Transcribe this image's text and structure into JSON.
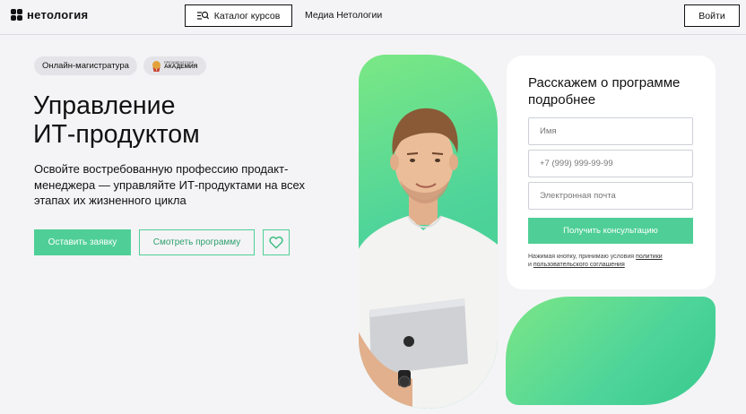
{
  "header": {
    "logo_text": "нетология",
    "catalog_label": "Каталог курсов",
    "media_label": "Медиа Нетологии",
    "login_label": "Войти"
  },
  "hero": {
    "badge_label": "Онлайн-магистратура",
    "academy_small": "ПРЕЗИДЕНТСКАЯ",
    "academy_big": "АКАДЕМИЯ",
    "title_line1": "Управление",
    "title_line2": "ИТ-продуктом",
    "subtitle": "Освойте востребованную профессию продакт-менеджера — управляйте ИТ-продуктами на всех этапах их жизненного цикла",
    "apply_label": "Оставить заявку",
    "program_label": "Смотреть программу"
  },
  "form": {
    "title": "Расскажем о программе подробнее",
    "name_placeholder": "Имя",
    "phone_placeholder": "+7 (999) 999-99-99",
    "email_placeholder": "Электронная почта",
    "submit_label": "Получить консультацию",
    "legal_prefix": "Нажимая кнопку, принимаю условия",
    "legal_link1": "политики",
    "legal_and": "и",
    "legal_link2": "пользовательского соглашения"
  },
  "colors": {
    "accent": "#4fcf97",
    "background": "#f4f4f6"
  },
  "icons": {
    "catalog": "catalog-search-icon",
    "favorite": "heart-icon",
    "academy": "academy-seal-icon"
  }
}
